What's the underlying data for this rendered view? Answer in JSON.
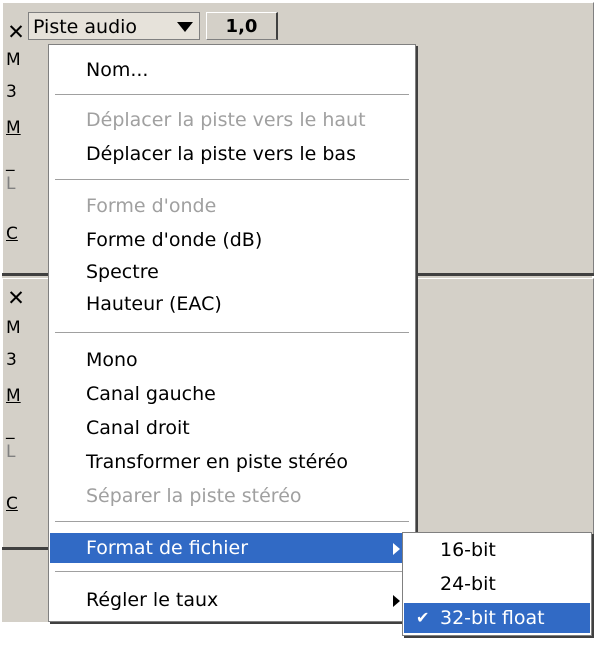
{
  "track1": {
    "close_glyph": "✕",
    "name": "Piste audio",
    "gain": "1,0",
    "frag_rows": [
      "M",
      "3",
      "M",
      "_",
      "L",
      "C"
    ]
  },
  "track2": {
    "close_glyph": "✕",
    "frag_rows": [
      "M",
      "3",
      "M",
      "_",
      "L",
      "C"
    ]
  },
  "menu": {
    "items": [
      {
        "label": "Nom...",
        "disabled": false
      },
      {
        "label": "Déplacer la piste vers le haut",
        "disabled": true
      },
      {
        "label": "Déplacer la piste vers le bas",
        "disabled": false
      },
      {
        "label": "Forme d'onde",
        "disabled": true
      },
      {
        "label": "Forme d'onde (dB)",
        "disabled": false
      },
      {
        "label": "Spectre",
        "disabled": false
      },
      {
        "label": "Hauteur (EAC)",
        "disabled": false
      },
      {
        "label": "Mono",
        "disabled": false
      },
      {
        "label": "Canal gauche",
        "disabled": false
      },
      {
        "label": "Canal droit",
        "disabled": false
      },
      {
        "label": "Transformer en piste stéréo",
        "disabled": false
      },
      {
        "label": "Séparer la piste stéréo",
        "disabled": true
      },
      {
        "label": "Format de fichier",
        "disabled": false,
        "highlighted": true,
        "submenu": true
      },
      {
        "label": "Régler le taux",
        "disabled": false,
        "submenu": true
      }
    ]
  },
  "submenu": {
    "items": [
      {
        "label": "16-bit",
        "checked": false
      },
      {
        "label": "24-bit",
        "checked": false
      },
      {
        "label": "32-bit float",
        "checked": true,
        "highlighted": true
      }
    ],
    "check_glyph": "✔"
  },
  "colors": {
    "highlight": "#316ac5",
    "disabled_text": "#a0a0a0",
    "chrome": "#d4d0c8"
  }
}
